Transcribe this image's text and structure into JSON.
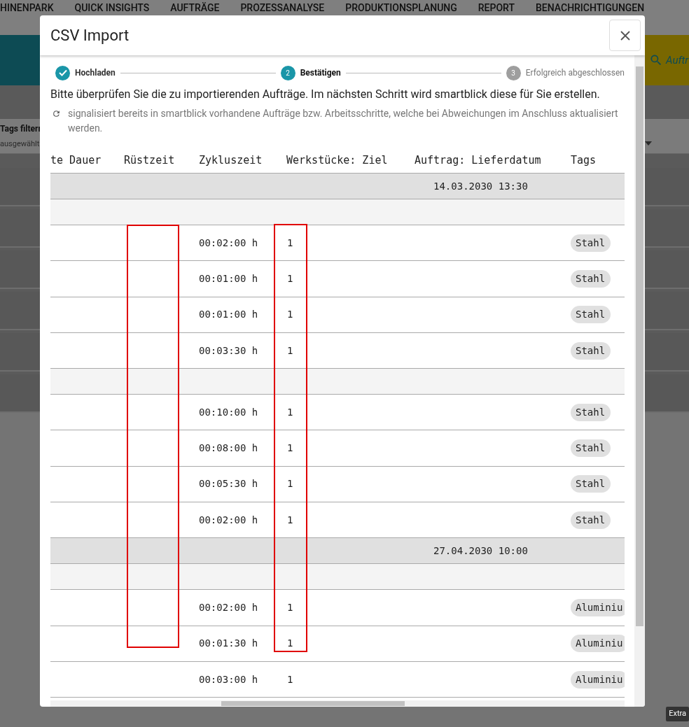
{
  "background": {
    "nav_items": [
      "HINENPARK",
      "QUICK INSIGHTS",
      "AUFTRÄGE",
      "PROZESSANALYSE",
      "PRODUKTIONSPLANUNG",
      "REPORT",
      "BENACHRICHTIGUNGEN"
    ],
    "search": {
      "placeholder": "Auftr"
    },
    "filter": {
      "label": "Tags filterr",
      "value": "ausgewählt"
    },
    "tooltip": "Extra"
  },
  "dialog": {
    "title": "CSV Import",
    "steps": [
      {
        "label": "Hochladen",
        "completed": true,
        "selected": false
      },
      {
        "label": "Bestätigen",
        "number": "2",
        "completed": false,
        "selected": true
      },
      {
        "label": "Erfolgreich abgeschlossen",
        "number": "3",
        "completed": false,
        "selected": false
      }
    ],
    "intro": "Bitte überprüfen Sie die zu importierenden Aufträge. Im nächsten Schritt wird smartblick diese für Sie erstellen.",
    "note": "signalisiert bereits in smartblick vorhandene Aufträge bzw. Arbeitsschritte, welche bei Abweichungen im Anschluss aktualisiert werden.",
    "table": {
      "columns": [
        {
          "label": "te Dauer",
          "highlighted": false
        },
        {
          "label": "Rüstzeit",
          "highlighted": true
        },
        {
          "label": "Zykluszeit",
          "highlighted": false
        },
        {
          "label": "Werkstücke: Ziel",
          "highlighted": true
        },
        {
          "label": "Auftrag: Lieferdatum",
          "highlighted": false
        },
        {
          "label": "Tags",
          "highlighted": false
        }
      ],
      "rows": [
        {
          "kind": "group",
          "delivery": "14.03.2030 13:30"
        },
        {
          "kind": "subgroup"
        },
        {
          "kind": "item",
          "cycle": "00:02:00 h",
          "target": "1",
          "tag": "Stahl"
        },
        {
          "kind": "item",
          "cycle": "00:01:00 h",
          "target": "1",
          "tag": "Stahl"
        },
        {
          "kind": "item",
          "cycle": "00:01:00 h",
          "target": "1",
          "tag": "Stahl"
        },
        {
          "kind": "item",
          "cycle": "00:03:30 h",
          "target": "1",
          "tag": "Stahl"
        },
        {
          "kind": "subgroup"
        },
        {
          "kind": "item",
          "cycle": "00:10:00 h",
          "target": "1",
          "tag": "Stahl"
        },
        {
          "kind": "item",
          "cycle": "00:08:00 h",
          "target": "1",
          "tag": "Stahl"
        },
        {
          "kind": "item",
          "cycle": "00:05:30 h",
          "target": "1",
          "tag": "Stahl"
        },
        {
          "kind": "item",
          "cycle": "00:02:00 h",
          "target": "1",
          "tag": "Stahl"
        },
        {
          "kind": "group",
          "delivery": "27.04.2030 10:00"
        },
        {
          "kind": "subgroup"
        },
        {
          "kind": "item",
          "cycle": "00:02:00 h",
          "target": "1",
          "tag": "Aluminiu"
        },
        {
          "kind": "item",
          "cycle": "00:01:30 h",
          "target": "1",
          "tag": "Aluminiu"
        },
        {
          "kind": "item",
          "cycle": "00:03:00 h",
          "target": "1",
          "tag": "Aluminiu"
        }
      ]
    }
  }
}
